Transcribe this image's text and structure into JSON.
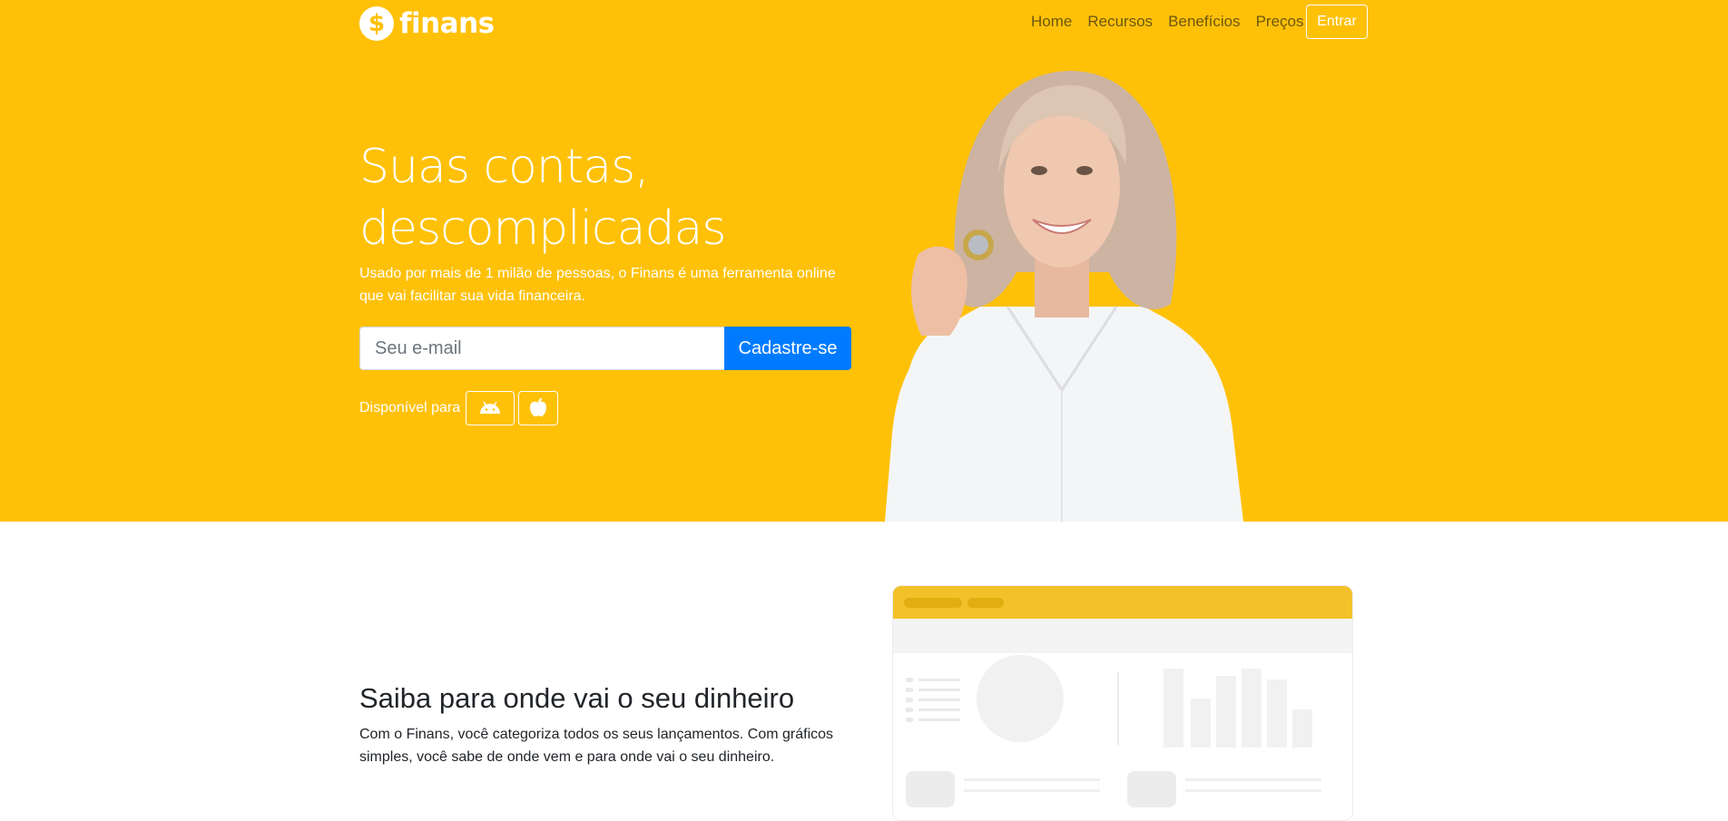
{
  "brand": {
    "logo_symbol": "$",
    "name": "finans"
  },
  "nav": {
    "items": [
      "Home",
      "Recursos",
      "Benefícios",
      "Preços"
    ],
    "login": "Entrar"
  },
  "hero": {
    "title_line1": "Suas contas,",
    "title_line2": "descomplicadas",
    "subtitle": "Usado por mais de 1 milão de pessoas, o Finans é uma ferramenta online que vai facilitar sua vida financeira.",
    "email_placeholder": "Seu e-mail",
    "signup_button": "Cadastre-se",
    "available_label": "Disponível para",
    "stores": [
      "android-icon",
      "apple-icon"
    ]
  },
  "feature": {
    "title": "Saiba para onde vai o seu dinheiro",
    "text": "Com o Finans, você categoriza todos os seus lançamentos. Com gráficos simples, você sabe de onde vem e para onde vai o seu dinheiro."
  },
  "colors": {
    "hero_bg": "#ffc107",
    "primary": "#007bff",
    "mock_header": "#f3c12a"
  }
}
